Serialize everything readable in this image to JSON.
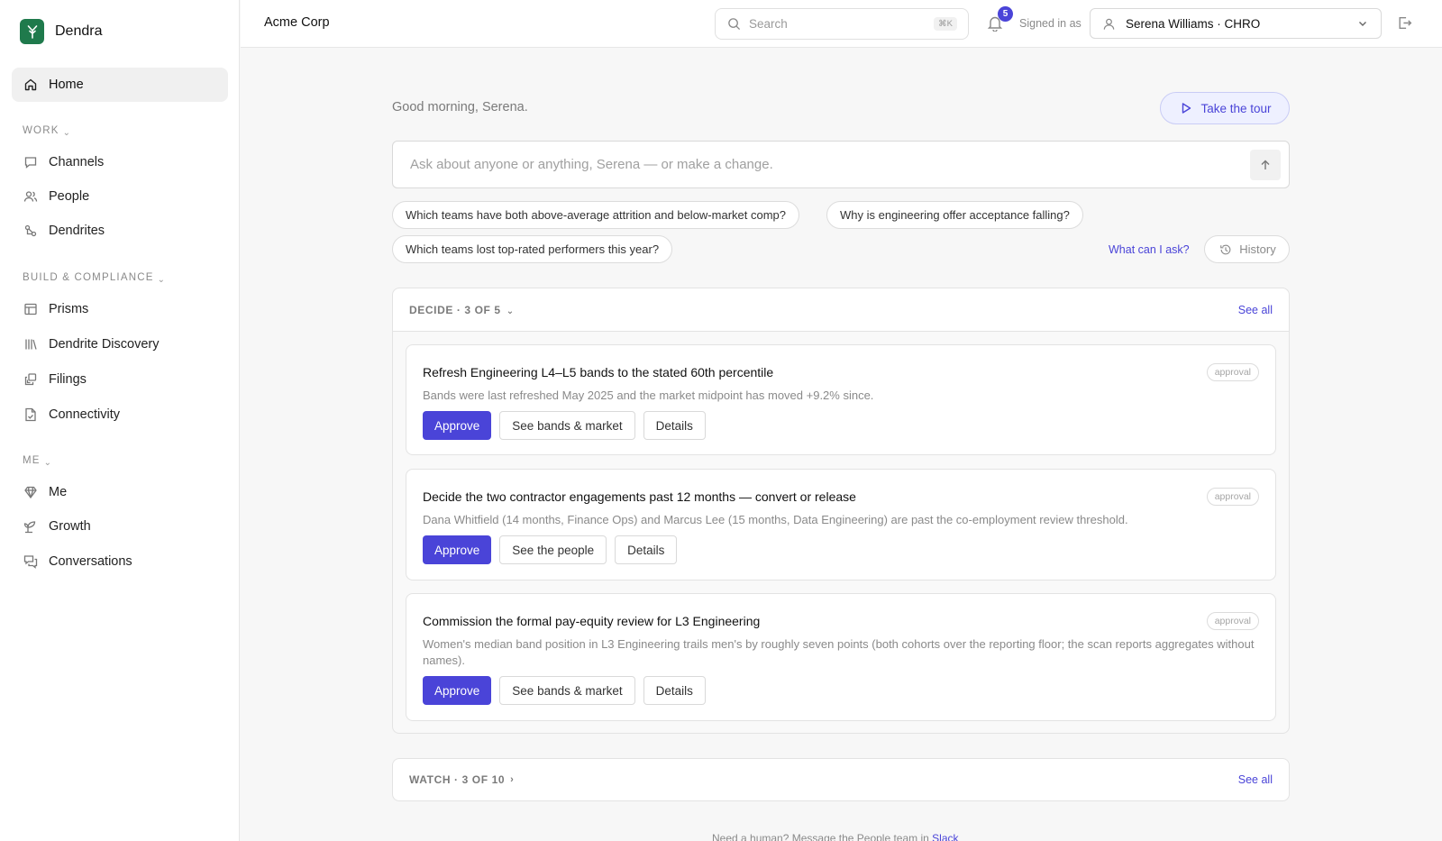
{
  "brand": {
    "name": "Dendra",
    "logo_icon": "dendra-logo-icon",
    "accent": "#1f7a4c"
  },
  "sidebar": {
    "home": {
      "label": "Home",
      "icon": "home-icon"
    },
    "sections": [
      {
        "heading": "WORK",
        "items": [
          {
            "label": "Channels",
            "icon": "chat-bubble-icon"
          },
          {
            "label": "People",
            "icon": "people-icon"
          },
          {
            "label": "Dendrites",
            "icon": "dendrites-icon"
          }
        ]
      },
      {
        "heading": "BUILD & COMPLIANCE",
        "items": [
          {
            "label": "Prisms",
            "icon": "table-icon"
          },
          {
            "label": "Dendrite Discovery",
            "icon": "library-icon"
          },
          {
            "label": "Filings",
            "icon": "filings-icon"
          },
          {
            "label": "Connectivity",
            "icon": "document-check-icon"
          }
        ]
      },
      {
        "heading": "ME",
        "items": [
          {
            "label": "Me",
            "icon": "gem-icon"
          },
          {
            "label": "Growth",
            "icon": "sprout-icon"
          },
          {
            "label": "Conversations",
            "icon": "conversations-icon"
          }
        ]
      }
    ]
  },
  "topbar": {
    "org": "Acme Corp",
    "search_placeholder": "Search",
    "search_shortcut": "⌘K",
    "notifications_count": "5",
    "signed_in_label": "Signed in as",
    "user": "Serena Williams · CHRO"
  },
  "main": {
    "greeting": "Good morning, Serena.",
    "tour_label": "Take the tour",
    "ask_placeholder": "Ask about anyone or anything, Serena — or make a change.",
    "suggestions": [
      "Which teams have both above-average attrition and below-market comp?",
      "Why is engineering offer acceptance falling?",
      "Which teams lost top-rated performers this year?"
    ],
    "what_can_i_ask": "What can I ask?",
    "history_label": "History",
    "decide": {
      "title": "DECIDE · 3 OF 5",
      "see_all": "See all",
      "cards": [
        {
          "title": "Refresh Engineering L4–L5 bands to the stated 60th percentile",
          "description": "Bands were last refreshed May 2025 and the market midpoint has moved +9.2% since.",
          "tag": "approval",
          "primary": "Approve",
          "secondary": "See bands & market",
          "tertiary": "Details"
        },
        {
          "title": "Decide the two contractor engagements past 12 months — convert or release",
          "description": "Dana Whitfield (14 months, Finance Ops) and Marcus Lee (15 months, Data Engineering) are past the co-employment review threshold.",
          "tag": "approval",
          "primary": "Approve",
          "secondary": "See the people",
          "tertiary": "Details"
        },
        {
          "title": "Commission the formal pay-equity review for L3 Engineering",
          "description": "Women's median band position in L3 Engineering trails men's by roughly seven points (both cohorts over the reporting floor; the scan reports aggregates without names).",
          "tag": "approval",
          "primary": "Approve",
          "secondary": "See bands & market",
          "tertiary": "Details"
        }
      ]
    },
    "watch": {
      "title": "WATCH · 3 OF 10",
      "see_all": "See all"
    },
    "footer_text": "Need a human? Message the People team in",
    "footer_link": "Slack"
  }
}
